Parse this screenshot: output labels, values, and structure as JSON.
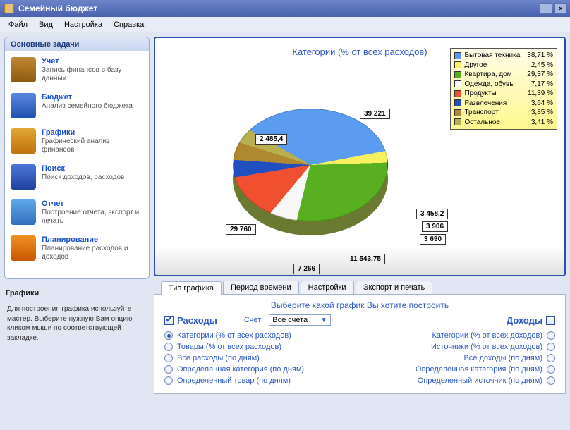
{
  "title": "Семейный бюджет",
  "menu": [
    "Файл",
    "Вид",
    "Настройка",
    "Справка"
  ],
  "sidebar_header": "Основные задачи",
  "tasks": [
    {
      "title": "Учет",
      "desc": "Запись финансов в базу данных",
      "icon": "ic-uchet"
    },
    {
      "title": "Бюджет",
      "desc": "Анализ семейного бюджета",
      "icon": "ic-budget"
    },
    {
      "title": "Графики",
      "desc": "Графический анализ финансов",
      "icon": "ic-graf"
    },
    {
      "title": "Поиск",
      "desc": "Поиск доходов, расходов",
      "icon": "ic-search"
    },
    {
      "title": "Отчет",
      "desc": "Построение отчета, экспорт и печать",
      "icon": "ic-report"
    },
    {
      "title": "Планирование",
      "desc": "Планирование расходов и доходов",
      "icon": "ic-plan"
    }
  ],
  "help": {
    "title": "Графики",
    "text": "Для построения графика используйте мастер. Выберите нужную Вам опцию кликом мыши по соответствующей закладке."
  },
  "tabs": [
    "Тип графика",
    "Период времени",
    "Настройки",
    "Экспорт и печать"
  ],
  "active_tab": 0,
  "chart_title": "Категории (% от всех расходов)",
  "legend": [
    {
      "name": "Бытовая техника",
      "pct": "38,71 %",
      "color": "#5a9cf0"
    },
    {
      "name": "Другое",
      "pct": "2,45 %",
      "color": "#f8f060"
    },
    {
      "name": "Квартира, дом",
      "pct": "29,37 %",
      "color": "#58b020"
    },
    {
      "name": "Одежда, обувь",
      "pct": "7,17 %",
      "color": "#f8f8f8"
    },
    {
      "name": "Продукты",
      "pct": "11,39 %",
      "color": "#f05030"
    },
    {
      "name": "Развлечения",
      "pct": "3,64 %",
      "color": "#2050c0"
    },
    {
      "name": "Транспорт",
      "pct": "3,85 %",
      "color": "#b08830"
    },
    {
      "name": "Остальное",
      "pct": "3,41 %",
      "color": "#b8b050"
    }
  ],
  "data_labels": {
    "l1": "39 221",
    "l2": "2 485,4",
    "l3": "29 760",
    "l4": "7 266",
    "l5": "11 543,75",
    "l6": "3 690",
    "l7": "3 906",
    "l8": "3 458,2"
  },
  "options": {
    "title": "Выберите какой график Вы хотите построить",
    "exp_label": "Расходы",
    "inc_label": "Доходы",
    "exp_checked": true,
    "inc_checked": false,
    "account_label": "Счет:",
    "account_value": "Все счета",
    "exp_opts": [
      "Категории (% от всех расходов)",
      "Товары (% от всех расходов)",
      "Все расходы (по дням)",
      "Определенная категория (по дням)",
      "Определенный товар (по дням)"
    ],
    "inc_opts": [
      "Категории (% от всех доходов)",
      "Источники (% от всех доходов)",
      "Все доходы (по дням)",
      "Определенная категория (по дням)",
      "Определенный источник (по дням)"
    ],
    "exp_selected": 0
  },
  "chart_data": {
    "type": "pie",
    "title": "Категории (% от всех расходов)",
    "series": [
      {
        "name": "Расходы",
        "values": [
          39221,
          2485.4,
          29760,
          7266,
          11543.75,
          3690,
          3906,
          3458.2
        ]
      }
    ],
    "categories": [
      "Бытовая техника",
      "Другое",
      "Квартира, дом",
      "Одежда, обувь",
      "Продукты",
      "Развлечения",
      "Транспорт",
      "Остальное"
    ],
    "percentages": [
      38.71,
      2.45,
      29.37,
      7.17,
      11.39,
      3.64,
      3.85,
      3.41
    ]
  }
}
